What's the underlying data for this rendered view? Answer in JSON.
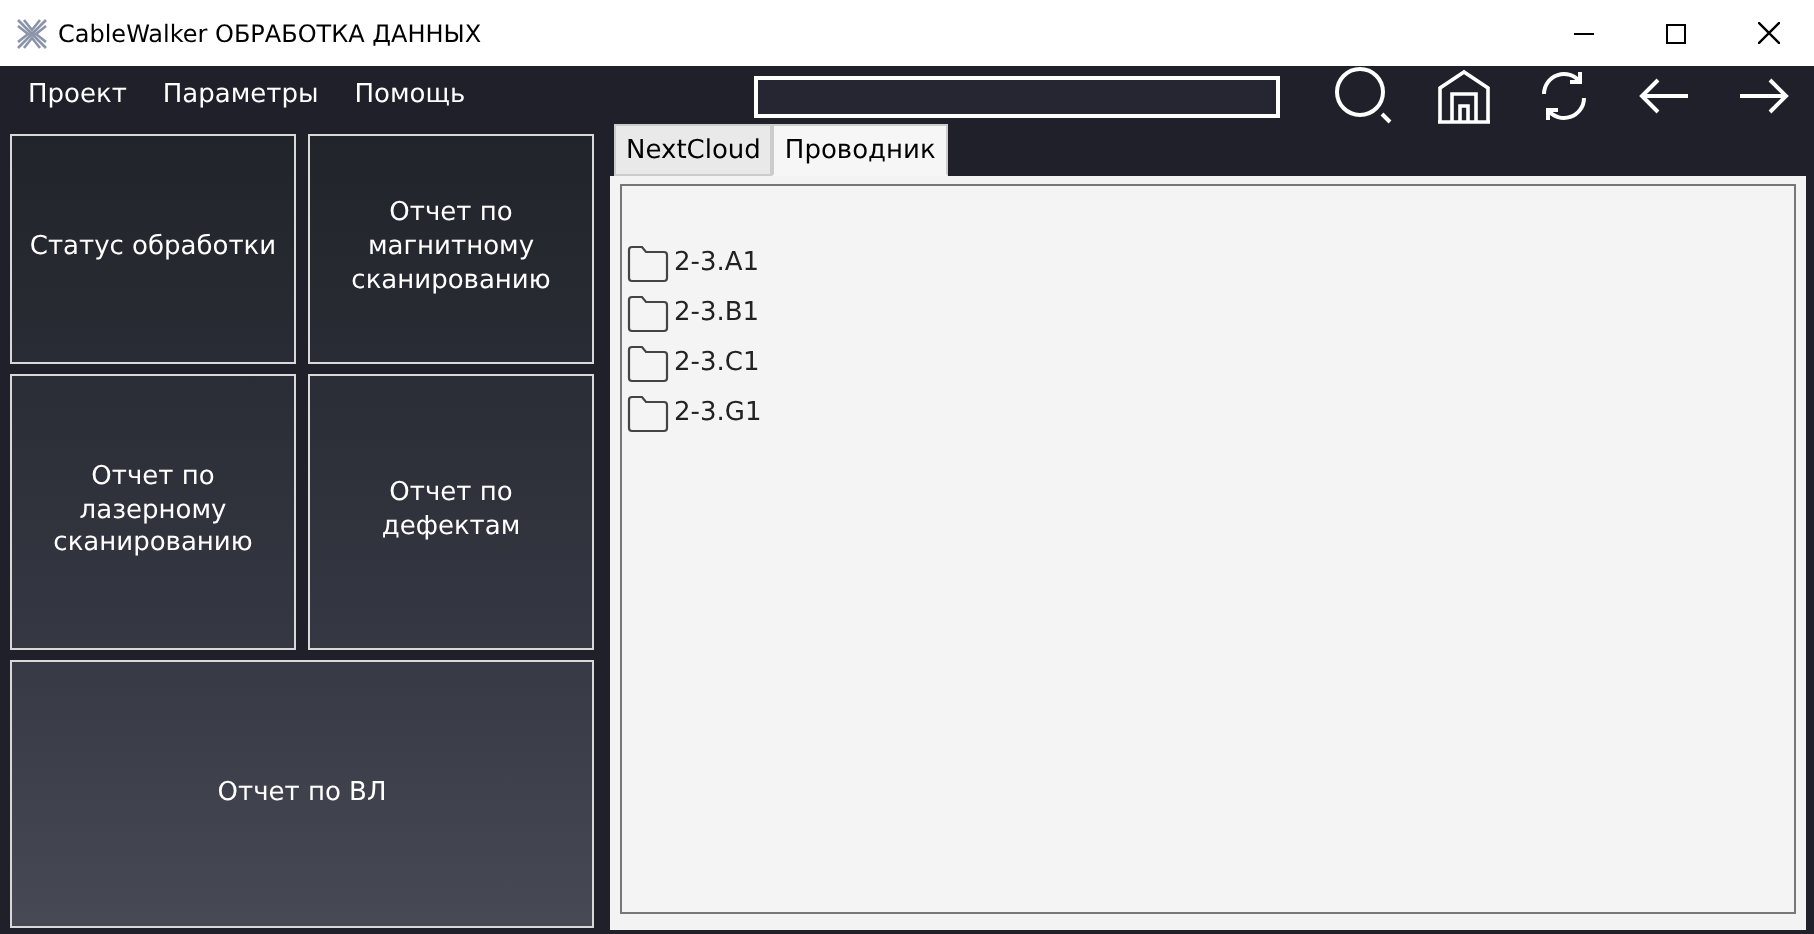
{
  "window": {
    "title": "CableWalker ОБРАБОТКА ДАННЫХ"
  },
  "menu": [
    "Проект",
    "Параметры",
    "Помощь"
  ],
  "tiles": [
    "Статус обработки",
    "Отчет по магнитному сканированию",
    "Отчет по лазерному сканированию",
    "Отчет по дефектам",
    "Отчет по ВЛ"
  ],
  "tabs": [
    {
      "label": "NextCloud",
      "selected": false
    },
    {
      "label": "Проводник",
      "selected": true
    }
  ],
  "folders": [
    "2-3.A1",
    "2-3.B1",
    "2-3.C1",
    "2-3.G1"
  ]
}
